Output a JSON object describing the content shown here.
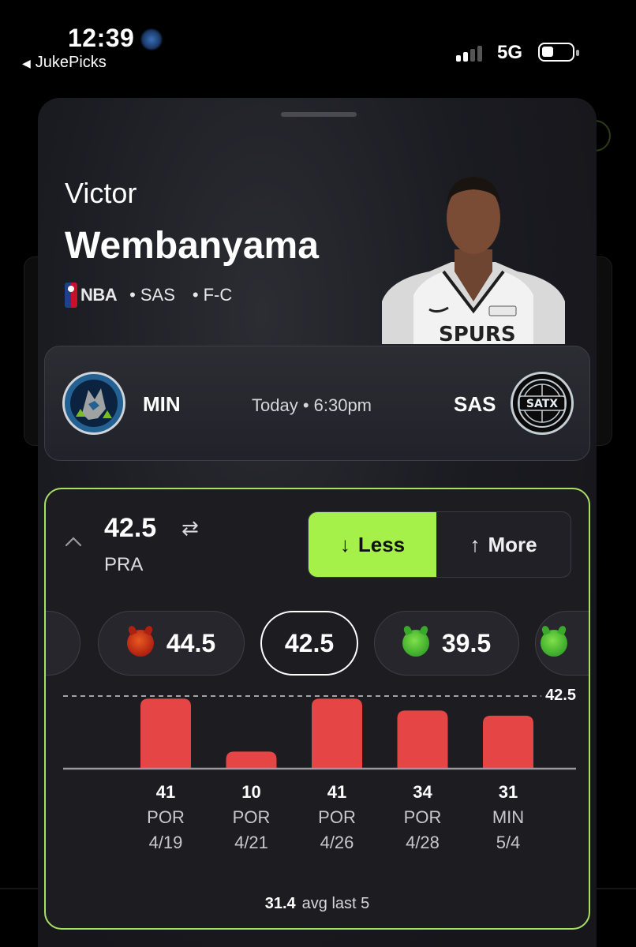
{
  "status_bar": {
    "time": "12:39",
    "back_app": "JukePicks",
    "network": "5G"
  },
  "player": {
    "first_name": "Victor",
    "last_name": "Wembanyama",
    "league": "NBA",
    "team": "SAS",
    "position": "F-C",
    "separator": "•"
  },
  "game": {
    "away_team": "MIN",
    "home_team": "SAS",
    "time": "Today • 6:30pm",
    "home_logo_text": "SATX"
  },
  "prop": {
    "line": "42.5",
    "stat": "PRA",
    "less_label": "Less",
    "more_label": "More",
    "selected": "Less",
    "alt_lines": [
      {
        "value": "44.5",
        "icon": "devil-face-icon"
      },
      {
        "value": "42.5",
        "icon": null
      },
      {
        "value": "39.5",
        "icon": "smiling-imp-icon"
      }
    ],
    "avg_value": "31.4",
    "avg_label": "avg last 5"
  },
  "chart_data": {
    "type": "bar",
    "line_label": "42.5",
    "line": 42.5,
    "categories": [
      "POR 4/19",
      "POR 4/21",
      "POR 4/26",
      "POR 4/28",
      "MIN 5/4"
    ],
    "values": [
      41,
      10,
      41,
      34,
      31
    ],
    "games": [
      {
        "value": "41",
        "opp": "POR",
        "date": "4/19"
      },
      {
        "value": "10",
        "opp": "POR",
        "date": "4/21"
      },
      {
        "value": "41",
        "opp": "POR",
        "date": "4/26"
      },
      {
        "value": "34",
        "opp": "POR",
        "date": "4/28"
      },
      {
        "value": "31",
        "opp": "MIN",
        "date": "5/4"
      }
    ],
    "bar_color": "#e64545",
    "ylim": [
      0,
      42.5
    ]
  },
  "colors": {
    "accent": "#a6f04a",
    "bar": "#e64545",
    "sheet": "#1b1b22"
  }
}
